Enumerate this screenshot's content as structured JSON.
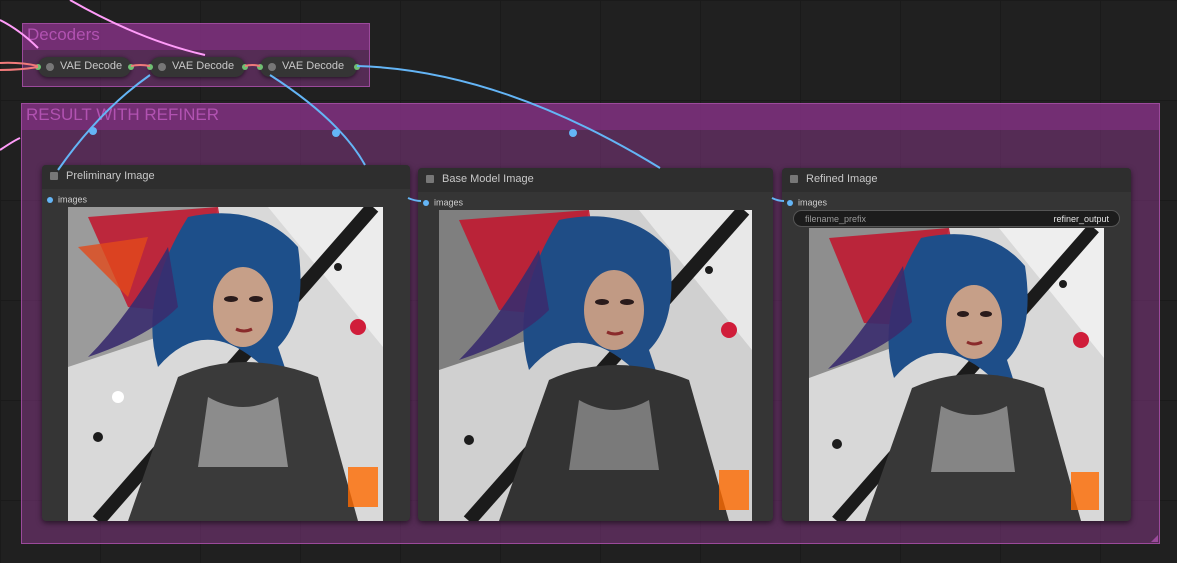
{
  "colors": {
    "group_fill": "#6b2b6b",
    "group_title": "#b152b1",
    "wire_image": "#64b5f6",
    "wire_latent": "#ff9cf9",
    "wire_vae": "#f07a7a",
    "node_bg": "#353535"
  },
  "groups": {
    "decoders": {
      "title": "Decoders"
    },
    "result": {
      "title": "RESULT WITH REFINER"
    }
  },
  "vae_nodes": [
    {
      "label": "VAE Decode"
    },
    {
      "label": "VAE Decode"
    },
    {
      "label": "VAE Decode"
    }
  ],
  "image_nodes": [
    {
      "title": "Preliminary Image",
      "input_label": "images",
      "preview_description": "fantasy warrior woman with blue hair, red paint splashes"
    },
    {
      "title": "Base Model Image",
      "input_label": "images",
      "preview_description": "fantasy warrior woman with blue hair, red paint splashes"
    },
    {
      "title": "Refined Image",
      "input_label": "images",
      "widget_label": "filename_prefix",
      "widget_value": "refiner_output",
      "preview_description": "fantasy warrior woman with blue hair, red paint splashes"
    }
  ]
}
